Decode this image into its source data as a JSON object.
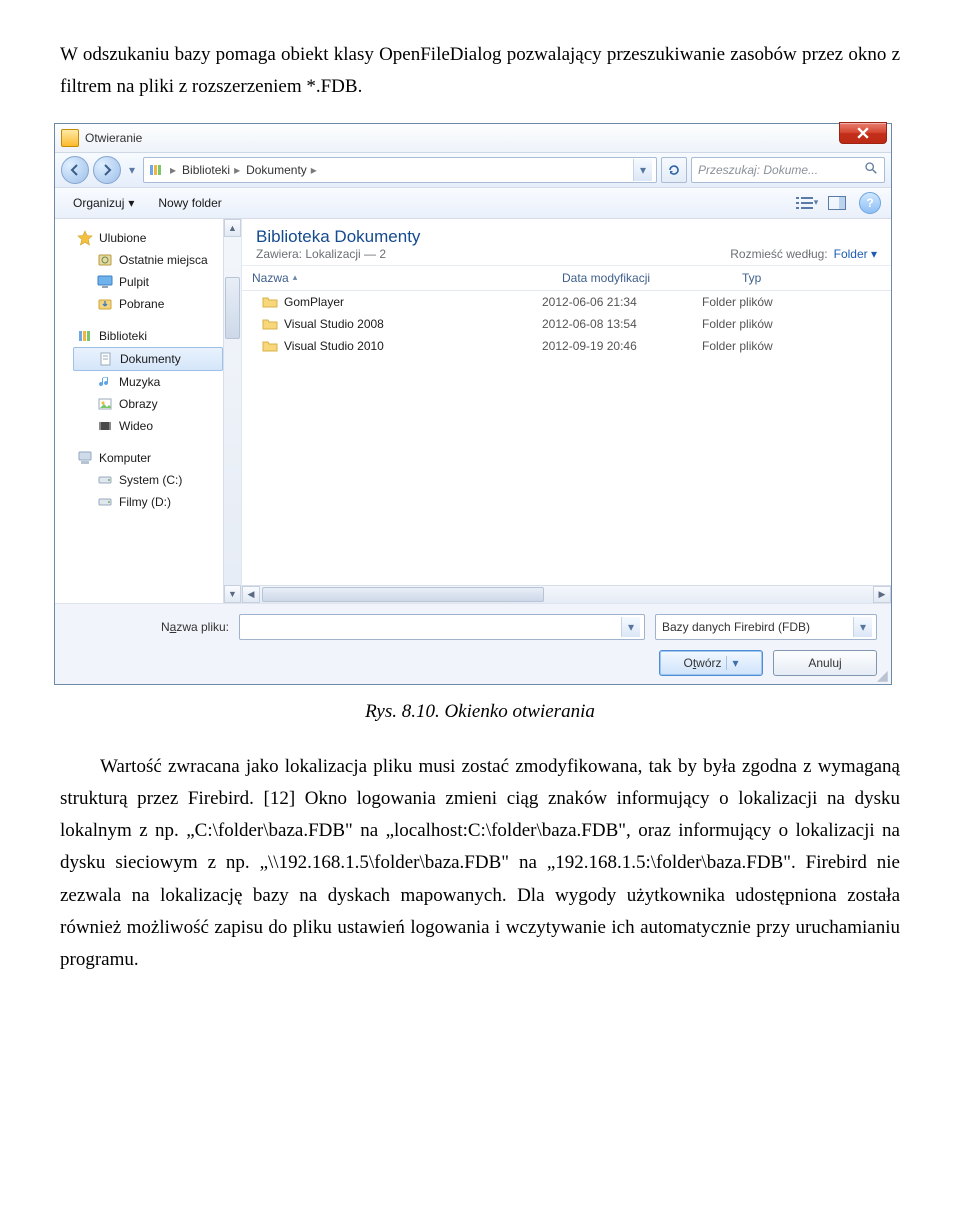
{
  "para_top": "W odszukaniu bazy pomaga obiekt klasy OpenFileDialog pozwalający przeszukiwanie zasobów przez okno z filtrem na pliki z rozszerzeniem *.FDB.",
  "caption": "Rys. 8.10. Okienko otwierania",
  "para_bottom": "Wartość zwracana jako lokalizacja pliku musi zostać zmodyfikowana, tak by była zgodna z wymaganą strukturą przez Firebird. [12] Okno logowania zmieni ciąg znaków informujący o lokalizacji na dysku lokalnym z np. „C:\\folder\\baza.FDB\" na „localhost:C:\\folder\\baza.FDB\", oraz informujący o lokalizacji na dysku sieciowym z np. „\\\\192.168.1.5\\folder\\baza.FDB\" na „192.168.1.5:\\folder\\baza.FDB\". Firebird nie zezwala na lokalizację bazy na dyskach mapowanych. Dla wygody użytkownika udostępniona została również możliwość zapisu do pliku ustawień logowania i wczytywanie ich automatycznie przy uruchamianiu programu.",
  "dialog": {
    "title": "Otwieranie",
    "breadcrumb": [
      "Biblioteki",
      "Dokumenty"
    ],
    "search_placeholder": "Przeszukaj: Dokume...",
    "toolbar": {
      "organize": "Organizuj",
      "newfolder": "Nowy folder"
    },
    "tree": {
      "favorites": {
        "label": "Ulubione",
        "items": [
          "Ostatnie miejsca",
          "Pulpit",
          "Pobrane"
        ]
      },
      "libraries": {
        "label": "Biblioteki",
        "items": [
          "Dokumenty",
          "Muzyka",
          "Obrazy",
          "Wideo"
        ]
      },
      "computer": {
        "label": "Komputer",
        "items": [
          "System (C:)",
          "Filmy (D:)"
        ]
      }
    },
    "mainheader": {
      "title": "Biblioteka Dokumenty",
      "subtitle": "Zawiera: Lokalizacji — 2",
      "sort_label": "Rozmieść według:",
      "sort_value": "Folder"
    },
    "columns": {
      "name": "Nazwa",
      "date": "Data modyfikacji",
      "type": "Typ"
    },
    "rows": [
      {
        "name": "GomPlayer",
        "date": "2012-06-06 21:34",
        "type": "Folder plików"
      },
      {
        "name": "Visual Studio 2008",
        "date": "2012-06-08 13:54",
        "type": "Folder plików"
      },
      {
        "name": "Visual Studio 2010",
        "date": "2012-09-19 20:46",
        "type": "Folder plików"
      }
    ],
    "footer": {
      "filename_label_pre": "N",
      "filename_label_ul": "a",
      "filename_label_post": "zwa pliku:",
      "filter": "Bazy danych Firebird (FDB)",
      "open_pre": "O",
      "open_ul": "t",
      "open_post": "wórz",
      "cancel": "Anuluj"
    }
  }
}
